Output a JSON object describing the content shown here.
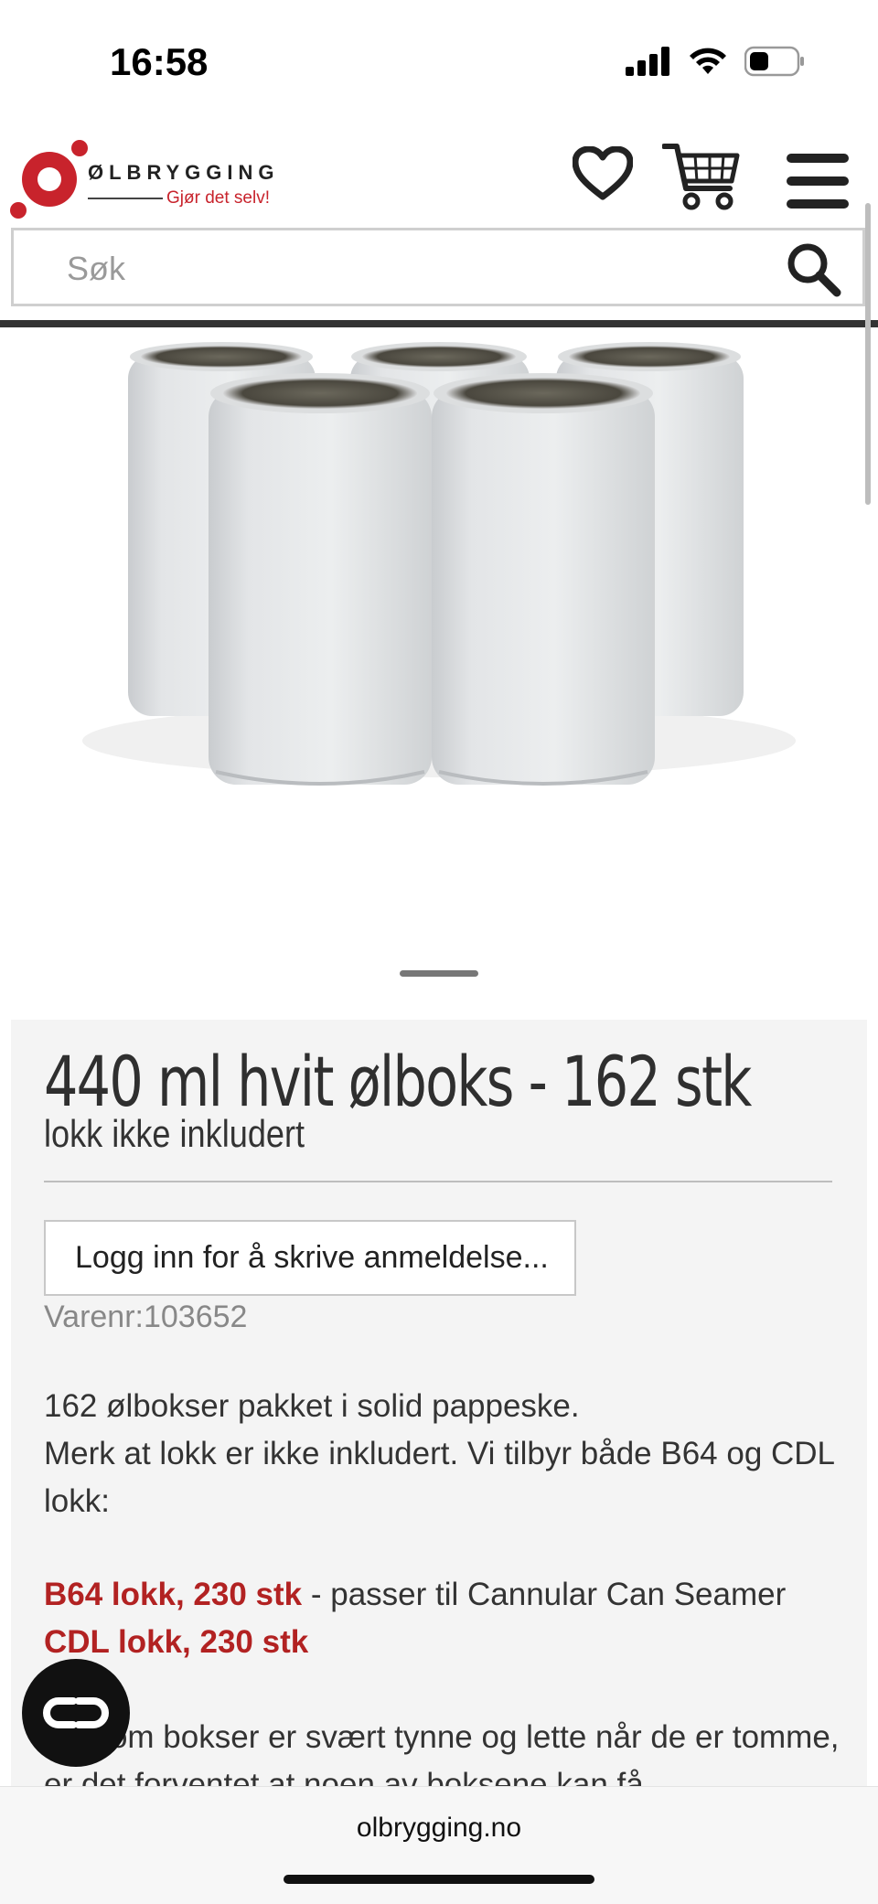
{
  "status_bar": {
    "time": "16:58"
  },
  "header": {
    "logo": {
      "wordmark": "ØLBRYGGING",
      "tagline": "Gjør det selv!"
    },
    "icons": [
      "heart-icon",
      "cart-icon",
      "menu-icon"
    ]
  },
  "search": {
    "placeholder": "Søk"
  },
  "product": {
    "title": "440 ml hvit ølboks - 162 stk",
    "subtitle": "lokk ikke inkludert",
    "review_button": "Logg inn for å skrive anmeldelse...",
    "sku": "Varenr:103652",
    "description": {
      "line1": "162 ølbokser pakket i solid pappeske.",
      "line2": "Merk at lokk er ikke inkludert. Vi tilbyr både B64 og CDL lokk:",
      "link1": "B64 lokk, 230 stk",
      "link1_suffix": " - passer til Cannular Can Seamer",
      "link2": "CDL lokk, 230 stk",
      "line3": "Da som bokser er svært tynne og lette når de er tomme, er det forventet at noen av boksene kan få"
    }
  },
  "browser": {
    "url": "olbrygging.no"
  },
  "colors": {
    "brand_red": "#c8232c",
    "link_red": "#b22222",
    "panel_bg": "#f4f4f4"
  }
}
